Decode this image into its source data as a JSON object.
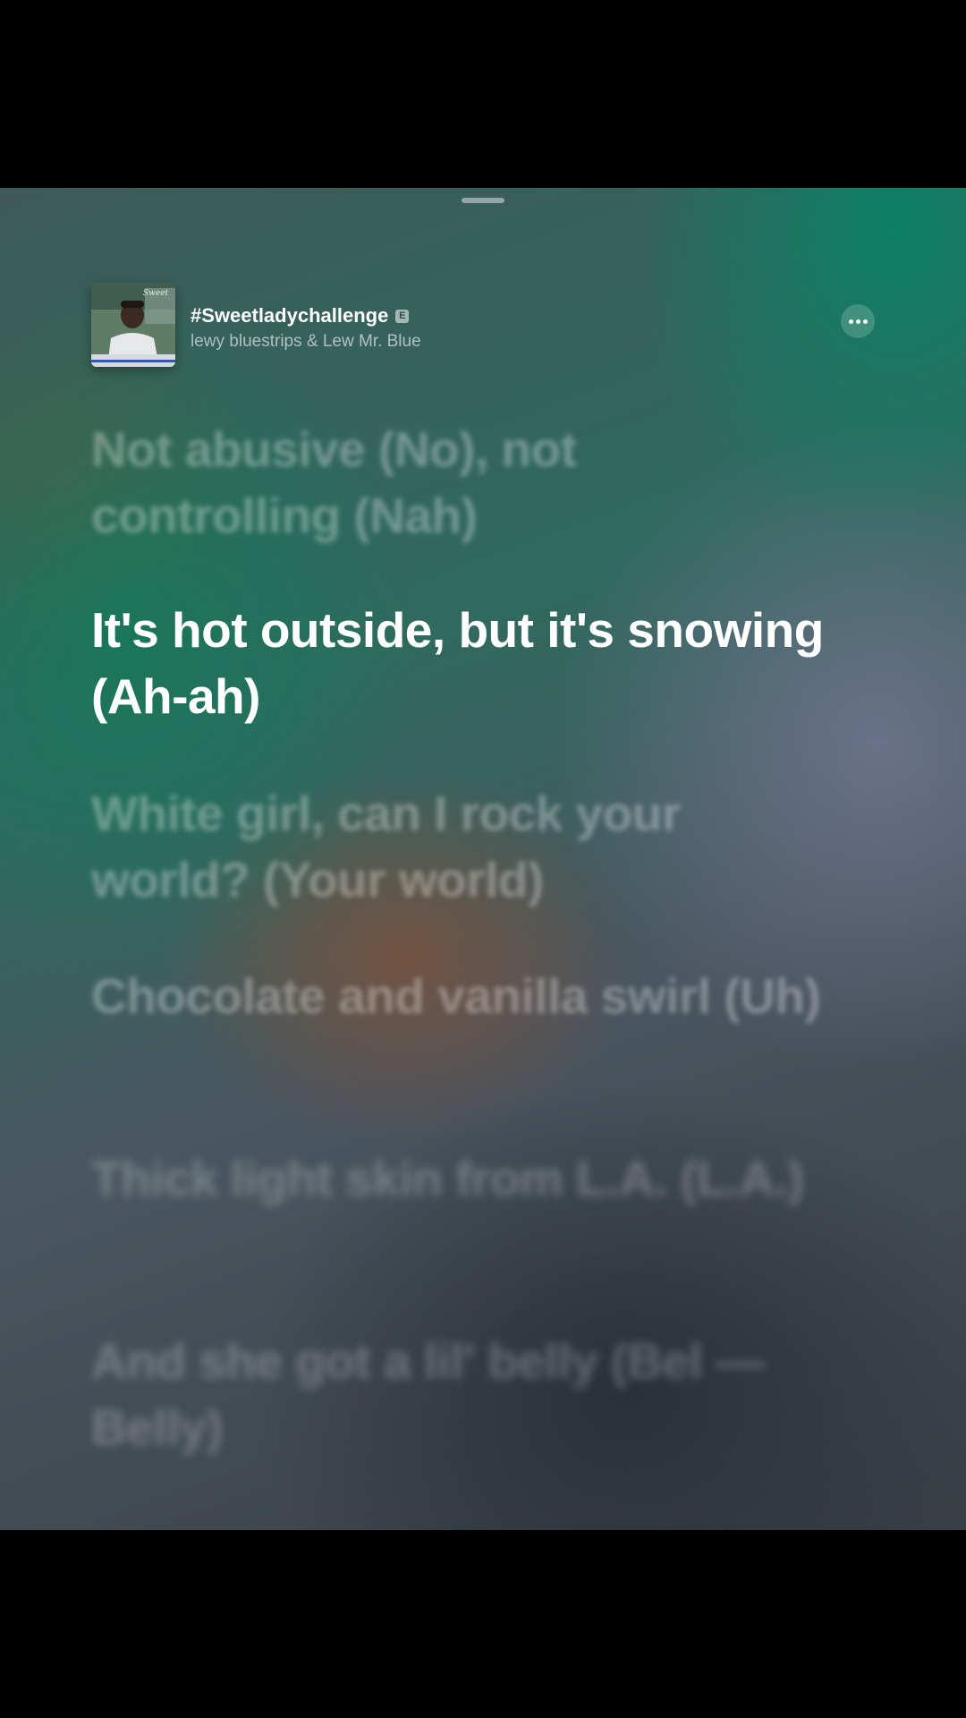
{
  "now_playing": {
    "title": "#Sweetladychallenge",
    "explicit_badge": "E",
    "artist": "lewy bluestrips & Lew Mr. Blue",
    "more_icon": "ellipsis-icon"
  },
  "lyrics": {
    "lines": [
      "Not abusive (No), not controlling (Nah)",
      "It's hot outside, but it's snowing (Ah-ah)",
      "White girl, can I rock your world? (Your world)",
      "Chocolate and vanilla swirl (Uh)",
      "Thick light skin from L.A. (L.A.)",
      "And she got a lil' belly (Bel — Belly)"
    ],
    "active_index": 1
  },
  "colors": {
    "accent_green": "#0a8264",
    "active_lyric": "#ffffff",
    "inactive_lyric": "rgba(255,255,255,0.32)"
  }
}
